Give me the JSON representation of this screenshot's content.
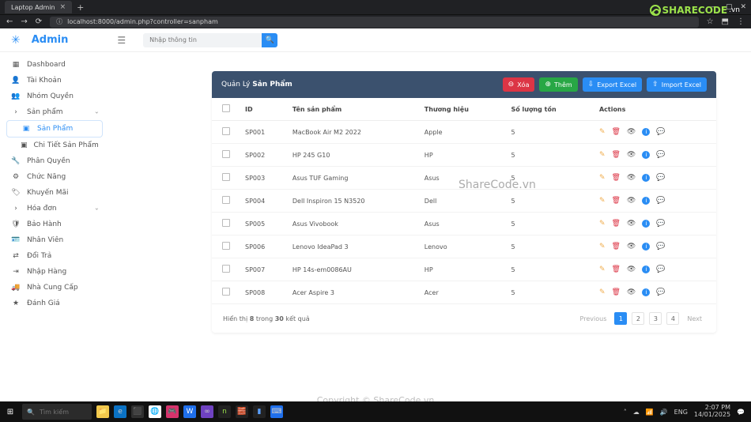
{
  "browser": {
    "tab_title": "Laptop Admin",
    "url": "localhost:8000/admin.php?controller=sanpham"
  },
  "header": {
    "brand": "Admin",
    "search_placeholder": "Nhập thông tin"
  },
  "sidebar": {
    "items": [
      {
        "icon": "dashboard",
        "label": "Dashboard"
      },
      {
        "icon": "user",
        "label": "Tài Khoản"
      },
      {
        "icon": "group",
        "label": "Nhóm Quyền"
      },
      {
        "icon": "chevron",
        "label": "Sản phẩm",
        "expandable": true
      },
      {
        "icon": "box",
        "label": "Sản Phẩm",
        "child": true,
        "active": true
      },
      {
        "icon": "box",
        "label": "Chi Tiết Sản Phẩm",
        "child": true
      },
      {
        "icon": "wrench",
        "label": "Phân Quyền"
      },
      {
        "icon": "gears",
        "label": "Chức Năng"
      },
      {
        "icon": "tag",
        "label": "Khuyến Mãi"
      },
      {
        "icon": "chevron",
        "label": "Hóa đơn",
        "expandable": true
      },
      {
        "icon": "shield",
        "label": "Bảo Hành"
      },
      {
        "icon": "idcard",
        "label": "Nhân Viên"
      },
      {
        "icon": "swap",
        "label": "Đổi Trả"
      },
      {
        "icon": "in",
        "label": "Nhập Hàng"
      },
      {
        "icon": "truck",
        "label": "Nhà Cung Cấp"
      },
      {
        "icon": "star",
        "label": "Đánh Giá"
      }
    ]
  },
  "panel": {
    "title_pre": "Quản Lý ",
    "title_strong": "Sản Phẩm",
    "buttons": {
      "delete": "Xóa",
      "add": "Thêm",
      "export": "Export Excel",
      "import": "Import Excel"
    }
  },
  "table": {
    "headers": {
      "id": "ID",
      "name": "Tên sản phẩm",
      "brand": "Thương hiệu",
      "stock": "Số lượng tồn",
      "actions": "Actions"
    },
    "rows": [
      {
        "id": "SP001",
        "name": "MacBook Air M2 2022",
        "brand": "Apple",
        "stock": "5"
      },
      {
        "id": "SP002",
        "name": "HP 245 G10",
        "brand": "HP",
        "stock": "5"
      },
      {
        "id": "SP003",
        "name": "Asus TUF Gaming",
        "brand": "Asus",
        "stock": "5"
      },
      {
        "id": "SP004",
        "name": "Dell Inspiron 15 N3520",
        "brand": "Dell",
        "stock": "5"
      },
      {
        "id": "SP005",
        "name": "Asus Vivobook",
        "brand": "Asus",
        "stock": "5"
      },
      {
        "id": "SP006",
        "name": "Lenovo IdeaPad 3",
        "brand": "Lenovo",
        "stock": "5"
      },
      {
        "id": "SP007",
        "name": "HP 14s-em0086AU",
        "brand": "HP",
        "stock": "5"
      },
      {
        "id": "SP008",
        "name": "Acer Aspire 3",
        "brand": "Acer",
        "stock": "5"
      }
    ]
  },
  "footer": {
    "text_a": "Hiển thị ",
    "shown": "8",
    "text_b": " trong ",
    "total": "30",
    "text_c": " kết quả",
    "prev": "Previous",
    "pages": [
      "1",
      "2",
      "3",
      "4"
    ],
    "next": "Next"
  },
  "watermarks": {
    "big": "ShareCode.vn",
    "bottom": "Copyright © ShareCode.vn",
    "logo": "SHARECODE",
    "logo_suffix": ".vn"
  },
  "taskbar": {
    "search_placeholder": "Tìm kiếm",
    "time": "2:07 PM",
    "date": "14/01/2025",
    "lang": "ENG"
  }
}
